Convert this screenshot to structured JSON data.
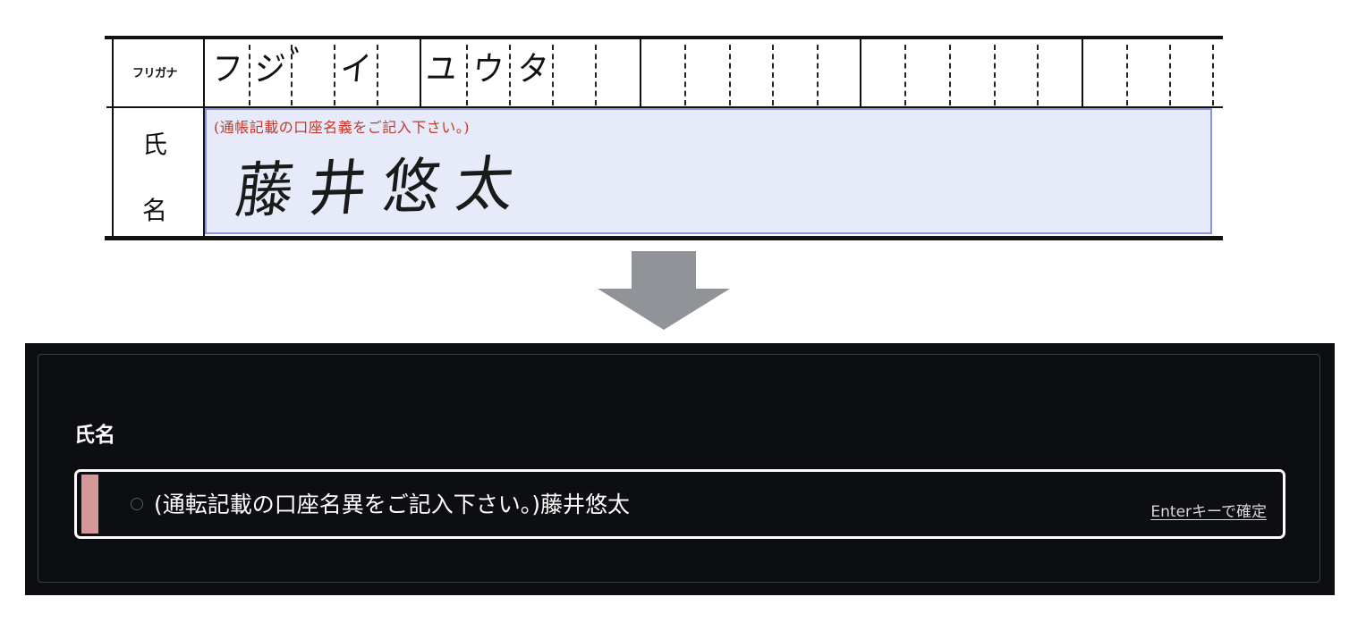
{
  "paper_form": {
    "furigana_label": "フリガナ",
    "name_label_char1": "氏",
    "name_label_char2": "名",
    "furigana_chars": [
      "フ",
      "ジ",
      "゛",
      "イ",
      "ユ",
      "ウ",
      "タ"
    ],
    "name_hint": "(通帳記載の口座名義をご記入下さい。)",
    "handwritten_name": "藤井悠太"
  },
  "digital_field": {
    "label": "氏名",
    "value": "(通転記載の口座名異をご記入下さい。)藤井悠太",
    "confirm_hint": "Enterキーで確定"
  },
  "colors": {
    "name_box_bg": "#e7eaf9",
    "name_box_border": "#8a95e8",
    "hint_red": "#c0392b",
    "dark_bg": "#0d0e12",
    "accent_bar": "#d59797",
    "arrow_gray": "#909397"
  },
  "icons": {
    "arrow": "arrow-down-icon",
    "status": "circle-outline-icon"
  }
}
